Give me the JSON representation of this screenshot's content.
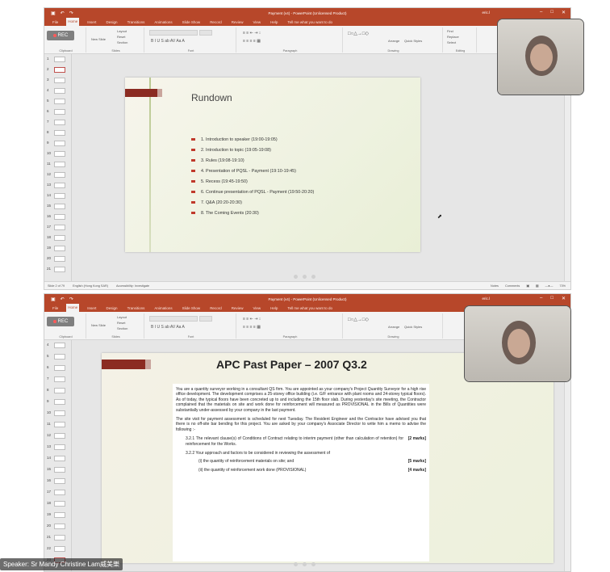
{
  "app": {
    "title": "Payment (v4) - PowerPoint (Unlicensed Product)",
    "user": "eric.l",
    "tabs": [
      "File",
      "Home",
      "Insert",
      "Design",
      "Transitions",
      "Animations",
      "Slide Show",
      "Record",
      "Review",
      "View",
      "Help"
    ],
    "tell_me": "Tell me what you want to do",
    "ribbon_groups": [
      "Clipboard",
      "Slides",
      "Font",
      "Paragraph",
      "Drawing",
      "Editing"
    ],
    "ribbon_buttons": {
      "paste": "Paste",
      "new_slide": "New Slide",
      "layout": "Layout",
      "reset": "Reset",
      "section": "Section",
      "arrange": "Arrange",
      "quick_styles": "Quick Styles",
      "find": "Find",
      "replace": "Replace",
      "select": "Select"
    }
  },
  "rec_label": "REC",
  "top_pane": {
    "status": {
      "slide_info": "Slide 2 of 79",
      "language": "English (Hong Kong SAR)",
      "accessibility": "Accessibility: Investigate",
      "notes": "Notes",
      "comments": "Comments",
      "zoom": "73%"
    },
    "thumbnails": [
      "1",
      "2",
      "3",
      "4",
      "5",
      "6",
      "7",
      "8",
      "9",
      "10",
      "11",
      "12",
      "13",
      "14",
      "15",
      "16",
      "17",
      "18",
      "19",
      "20",
      "21"
    ],
    "slide": {
      "title": "Rundown",
      "items": [
        "1. Introduction to speaker (19:00-19:05)",
        "2. Introduction to topic (19:05-19:08)",
        "3. Rules (19:08-19:10)",
        "4. Presentation of PQSL - Payment (19:10-19:45)",
        "5. Recess (19:45-19:50)",
        "6. Continue presentation of PQSL - Payment (19:50-20:20)",
        "7. Q&A (20:20-20:30)",
        "8. The Coming Events (20:30)"
      ]
    }
  },
  "bottom_pane": {
    "thumbnails": [
      "4",
      "5",
      "6",
      "7",
      "8",
      "9",
      "10",
      "11",
      "12",
      "13",
      "14",
      "15",
      "16",
      "17",
      "18",
      "19",
      "20",
      "21",
      "22",
      "23"
    ],
    "slide": {
      "title": "APC Past Paper – 2007 Q3.2",
      "para1": "You are a quantity surveyor working in a consultant QS firm. You are appointed as your company's Project Quantity Surveyor for a high rise office development. The development comprises a 25-storey office building (i.e. G/F entrance with plant rooms and 24-storey typical floors). As of today, the typical floors have been concreted up to and including the 15th floor slab. During yesterday's site meeting, the Contractor complained that the materials on site and work done for reinforcement will measured as PROVISIONAL in the Bills of Quantities were substantially under-assessed by your company in the last payment.",
      "para2": "The site visit for payment assessment is scheduled for next Tuesday. The Resident Engineer and the Contractor have advised you that there is no off-site bar bending for this project. You are asked by your company's Associate Director to write him a memo to advise the following :-",
      "q321": "3.2.1 The relevant clause(s) of Conditions of Contract relating to interim payment (other than calculation of retention) for reinforcement for the Works.",
      "q321_marks": "[2 marks]",
      "q322": "3.2.2 Your approach and factors to be considered in reviewing the assessment of",
      "q322i": "(i) the quantity of reinforcement materials on site; and",
      "q322i_marks": "[5 marks]",
      "q322ii": "(ii) the quantity of reinforcement work done (PROVISIONAL)",
      "q322ii_marks": "[4 marks]"
    },
    "speaker": "Speaker: Sr Mandy Christine Lam威美樂"
  },
  "colors": {
    "accent": "#b7472a",
    "bullet": "#c0392b",
    "highlight": "#d9534f"
  }
}
